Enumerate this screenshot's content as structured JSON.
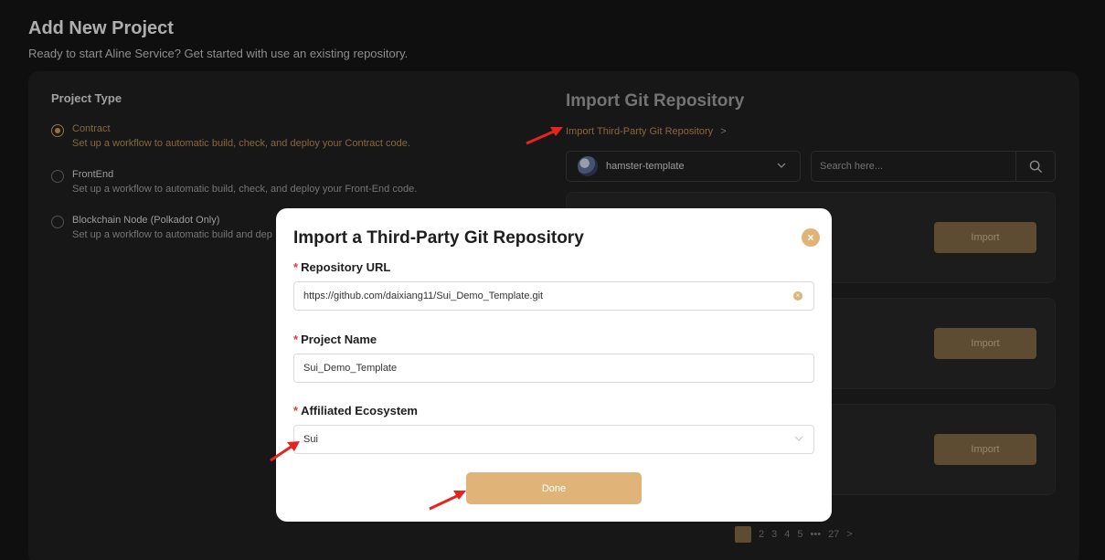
{
  "page": {
    "title": "Add New Project",
    "subtitle": "Ready to start Aline Service? Get started with use an existing repository."
  },
  "project_type": {
    "label": "Project Type",
    "options": [
      {
        "title": "Contract",
        "desc": "Set up a workflow to automatic build, check, and deploy your Contract code.",
        "selected": true
      },
      {
        "title": "FrontEnd",
        "desc": "Set up a workflow to automatic build, check, and deploy your Front-End code.",
        "selected": false
      },
      {
        "title": "Blockchain Node (Polkadot Only)",
        "desc": "Set up a workflow to automatic build and dep",
        "selected": false
      }
    ]
  },
  "import_git": {
    "title": "Import Git Repository",
    "third_party_link": "Import Third-Party Git Repository",
    "chevron": ">",
    "account": "hamster-template",
    "search_placeholder": "Search here...",
    "import_label": "Import"
  },
  "pagination": {
    "pages": [
      "1",
      "2",
      "3",
      "4",
      "5"
    ],
    "ellipsis": "•••",
    "last": "27",
    "next": ">"
  },
  "modal": {
    "title": "Import a Third-Party Git Repository",
    "close": "×",
    "required_mark": "*",
    "repo_url_label": "Repository URL",
    "repo_url_value": "https://github.com/daixiang11/Sui_Demo_Template.git",
    "project_name_label": "Project Name",
    "project_name_value": "Sui_Demo_Template",
    "ecosystem_label": "Affiliated Ecosystem",
    "ecosystem_value": "Sui",
    "done_label": "Done"
  },
  "colors": {
    "accent": "#e0b478",
    "accent_dark": "#7c6642",
    "link": "#b78a50",
    "annotation_arrow": "#e8231e"
  }
}
